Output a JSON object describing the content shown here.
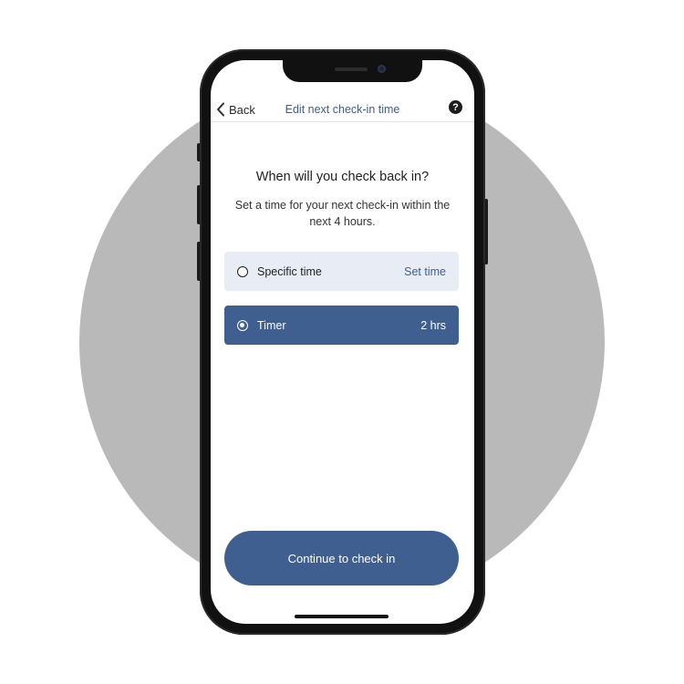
{
  "nav": {
    "back_label": "Back",
    "title": "Edit next check-in time",
    "help_symbol": "?"
  },
  "content": {
    "heading": "When will you check back in?",
    "subtitle": "Set a time for your next check-in within the next 4 hours."
  },
  "options": [
    {
      "label": "Specific time",
      "value": "Set time",
      "selected": false
    },
    {
      "label": "Timer",
      "value": "2 hrs",
      "selected": true
    }
  ],
  "continue_label": "Continue to check in",
  "colors": {
    "accent": "#3e5f8f",
    "option_unselected_bg": "#e8edf5",
    "background_circle": "#b9b9b9"
  },
  "icons": {
    "back": "chevron-left-icon",
    "help": "question-circle-icon",
    "radio_off": "radio-unselected-icon",
    "radio_on": "radio-selected-icon"
  }
}
